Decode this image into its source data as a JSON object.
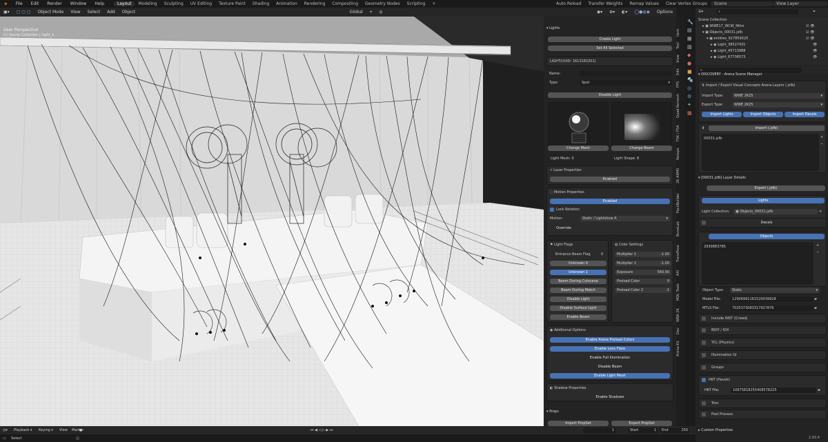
{
  "topmenu": {
    "items": [
      "File",
      "Edit",
      "Render",
      "Window",
      "Help"
    ],
    "workspaces": [
      "Layout",
      "Modeling",
      "Sculpting",
      "UV Editing",
      "Texture Paint",
      "Shading",
      "Animation",
      "Rendering",
      "Compositing",
      "Geometry Nodes",
      "Scripting"
    ],
    "active_workspace": "Layout",
    "right_tools": [
      "Auto Reload",
      "Transfer Weights",
      "Remap Values",
      "Clear Vertex Groups"
    ],
    "scene": "Scene",
    "view_layer": "View Layer"
  },
  "viewport_header": {
    "mode": "Object Mode",
    "menus": [
      "View",
      "Select",
      "Add",
      "Object"
    ],
    "orientation": "Global",
    "options": "Options"
  },
  "viewport": {
    "label": "User Perspective",
    "collection": "(1) Scene Collection | Light_1"
  },
  "npanel": {
    "title": "Lights",
    "create_light": "Create Light",
    "set_all_selected": "Set All Selected",
    "light_uuid": "LIGHT(UUID: 1613183201)",
    "name_label": "Name:",
    "name_value": "",
    "type_label": "Type:",
    "type_value": "Spot",
    "disable_light": "Disable Light",
    "change_mesh": "Change Mesh",
    "change_beam": "Change Beam",
    "light_mesh": "Light Mesh: 0",
    "light_shape": "Light Shape: 8",
    "laser_properties": "Laser Properties",
    "laser_enabled": "Enabled",
    "motion_properties": "Motion Properties",
    "motion_enabled": "Enabled",
    "lock_rotation": "Lock Rotation",
    "motion_label": "Motion:",
    "motion_value": "Static / Lightshow A",
    "override": "Override",
    "light_flags_title": "Light Flags",
    "entrance_flag_label": "Entrance Beam Flag",
    "entrance_flag_value": "0",
    "flags": [
      "Unknown 0",
      "Unknown 1",
      "Beam During Cutscene",
      "Beam During Match",
      "Disable Light",
      "Disable Surface Light",
      "Enable Beam"
    ],
    "color_settings_title": "Color Settings",
    "color_settings": [
      {
        "label": "Multiplier 1",
        "value": "-1.00"
      },
      {
        "label": "Multiplier 2",
        "value": "-1.00"
      },
      {
        "label": "Exposure",
        "value": "560.00"
      },
      {
        "label": "Preload Color",
        "value": "0"
      },
      {
        "label": "Preload Color 2",
        "value": "-1"
      }
    ],
    "additional_options": "Additional Options",
    "additional_buttons": [
      "Enable Arena Preload Colors",
      "Enable Lens Flare",
      "Enable Full Illumination",
      "Disable Beam",
      "Enable Light Mesh"
    ],
    "shadow_properties": "Shadow Properties",
    "enable_shadows": "Enable Shadows",
    "props": "Props",
    "import_propset": "Import PropSet",
    "export_propset": "Export PropSet"
  },
  "ntabs": [
    "Item",
    "Tool",
    "View",
    "Edit",
    "FPS",
    "Quad Remesh",
    "FSK / FSA",
    "Retopo",
    "2K ARMS",
    "PackBuilder",
    "BoneLab",
    "TransPose",
    "AXI",
    "MDL Tools",
    "WBA 2K",
    "Dev",
    "Arena Kit"
  ],
  "outliner": {
    "root": "Scene Collection",
    "items": [
      {
        "label": "WWE17_WCW_Nitro",
        "depth": 1
      },
      {
        "label": "Objects_00031.jsfb",
        "depth": 1
      },
      {
        "label": "entities_927859020",
        "depth": 2
      },
      {
        "label": "Light_38527431",
        "depth": 3
      },
      {
        "label": "Light_45713988",
        "depth": 3
      },
      {
        "label": "Light_67738573",
        "depth": 3
      }
    ]
  },
  "properties": {
    "addon_title": "DISCOVERY - Arena Scene Manager",
    "import_export_title": "Import / Export Visual Concepts Arena Layers (.jsfb)",
    "import_type_label": "Import Type:",
    "import_type_value": "WWE 2K25",
    "export_type_label": "Export Type:",
    "export_type_value": "WWE 2K25",
    "import_lights": "Import Lights",
    "import_objects": "Import Objects",
    "import_decals": "Import Decals",
    "import_jsfb": "Import (.jsfb)",
    "file_item": "00031.jsfb",
    "layer_details": "[00031.jsfb] Layer Details",
    "export_jsfb": "Export (.jsfb)",
    "lights": "Lights",
    "light_collection_label": "Light Collection:",
    "light_collection_value": "Objects_00031.jsfb",
    "decals": "Decals",
    "objects": "Objects",
    "object_id": "2930883785",
    "object_type_label": "Object Type:",
    "object_type_value": "Static",
    "model_file_label": "Model File:",
    "model_file_value": "12906991161520039928",
    "mtls_file_label": "MTLS File:",
    "mtls_file_value": "7025373083317927876",
    "include_inst": "Include INST (Crowd)",
    "bdiy_idx": "BDIY / IDX",
    "ycl_physics": "YCL (Physics)",
    "illumination_gi": "Illumination GI",
    "groups": "Groups",
    "hkt_havok": "HKT (Havok)",
    "hkt_file_label": "HKT File:",
    "hkt_file_value": "10675818255408578225",
    "tron": "Tron",
    "post_process": "Post Process",
    "custom_properties": "Custom Properties"
  },
  "timeline": {
    "menus": [
      "Playback",
      "Keying",
      "View",
      "Marker"
    ],
    "current_frame": "1",
    "start_label": "Start",
    "start_value": "1",
    "end_label": "End",
    "end_value": "250"
  },
  "status": {
    "left": "Select",
    "version": "2.93.4"
  }
}
